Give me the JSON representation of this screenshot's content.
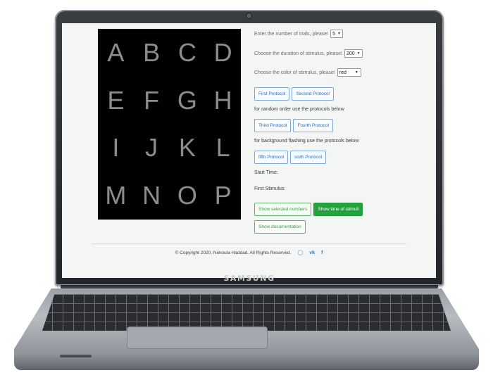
{
  "device": {
    "brand": "SAMSUNG"
  },
  "stimulus_grid": {
    "letters": [
      "A",
      "B",
      "C",
      "D",
      "E",
      "F",
      "G",
      "H",
      "I",
      "J",
      "K",
      "L",
      "M",
      "N",
      "O",
      "P"
    ]
  },
  "controls": {
    "trials": {
      "label": "Enter the number of trials, please!",
      "value": "5"
    },
    "duration": {
      "label": "Choose the duration of stimulus, please!",
      "value": "200"
    },
    "color": {
      "label": "Choose the color of stimulus, please!",
      "value": "red"
    },
    "buttons": {
      "first_protocol": "First Protocol",
      "second_protocol": "Second Protocol",
      "third_protocol": "Third Protocol",
      "fourth_protocol": "Fourth Protocol",
      "fifth_protocol": "fifth Protocol",
      "sixth_protocol": "sixth Protocol",
      "show_selected_numbers": "Show selected numbers",
      "show_time_of_stimuli": "Show time of stimuli",
      "show_documentation": "Show documentation"
    },
    "random_order_note": "for random order use the protocols below",
    "background_flashing_note": "for background flashing use the protocols below",
    "start_time_label": "Start Time:",
    "first_stimulus_label": "First Stimulus:"
  },
  "footer": {
    "copyright": "© Copyright 2020, Nekoula Haddad. All Rights Reserved.",
    "icons": [
      "github-icon",
      "vk-icon",
      "facebook-icon"
    ]
  },
  "colors": {
    "grid_background": "#000000",
    "letter": "#8c8c8c",
    "button_border": "#7ea9db",
    "green_button": "#22a33d"
  }
}
